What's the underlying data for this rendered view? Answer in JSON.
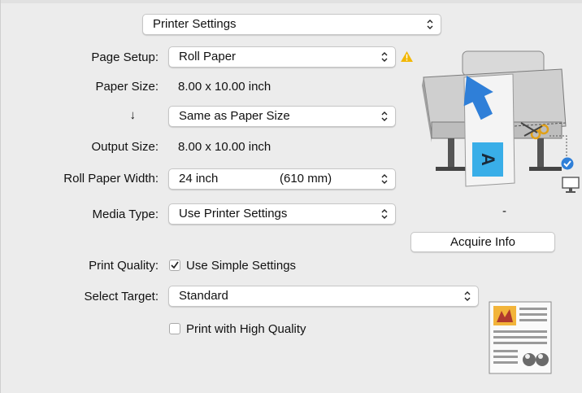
{
  "header": {
    "dropdown_value": "Printer Settings"
  },
  "page_setup": {
    "label": "Page Setup:",
    "value": "Roll Paper"
  },
  "paper_size": {
    "label": "Paper Size:",
    "value": "8.00 x 10.00 inch"
  },
  "scale_to": {
    "label": "↓",
    "value": "Same as Paper Size"
  },
  "output_size": {
    "label": "Output Size:",
    "value": "8.00 x 10.00 inch"
  },
  "roll_paper_width": {
    "label": "Roll Paper Width:",
    "value_inch": "24 inch",
    "value_mm": "(610 mm)"
  },
  "media_type": {
    "label": "Media Type:",
    "value": "Use Printer Settings"
  },
  "status_dash": "-",
  "acquire_info_label": "Acquire Info",
  "print_quality": {
    "label": "Print Quality:",
    "checkbox_label": "Use Simple Settings",
    "checked": true
  },
  "select_target": {
    "label": "Select Target:",
    "value": "Standard"
  },
  "high_quality": {
    "checkbox_label": "Print with High Quality",
    "checked": false
  },
  "icons": {
    "warning": "warning-icon",
    "printer": "printer-illustration",
    "check": "check-badge-icon",
    "computer": "computer-icon",
    "quality_preview": "document-preview-icon"
  },
  "colors": {
    "panel_bg": "#ececec",
    "warning": "#f2b705",
    "accent_blue": "#2f7fd8"
  }
}
